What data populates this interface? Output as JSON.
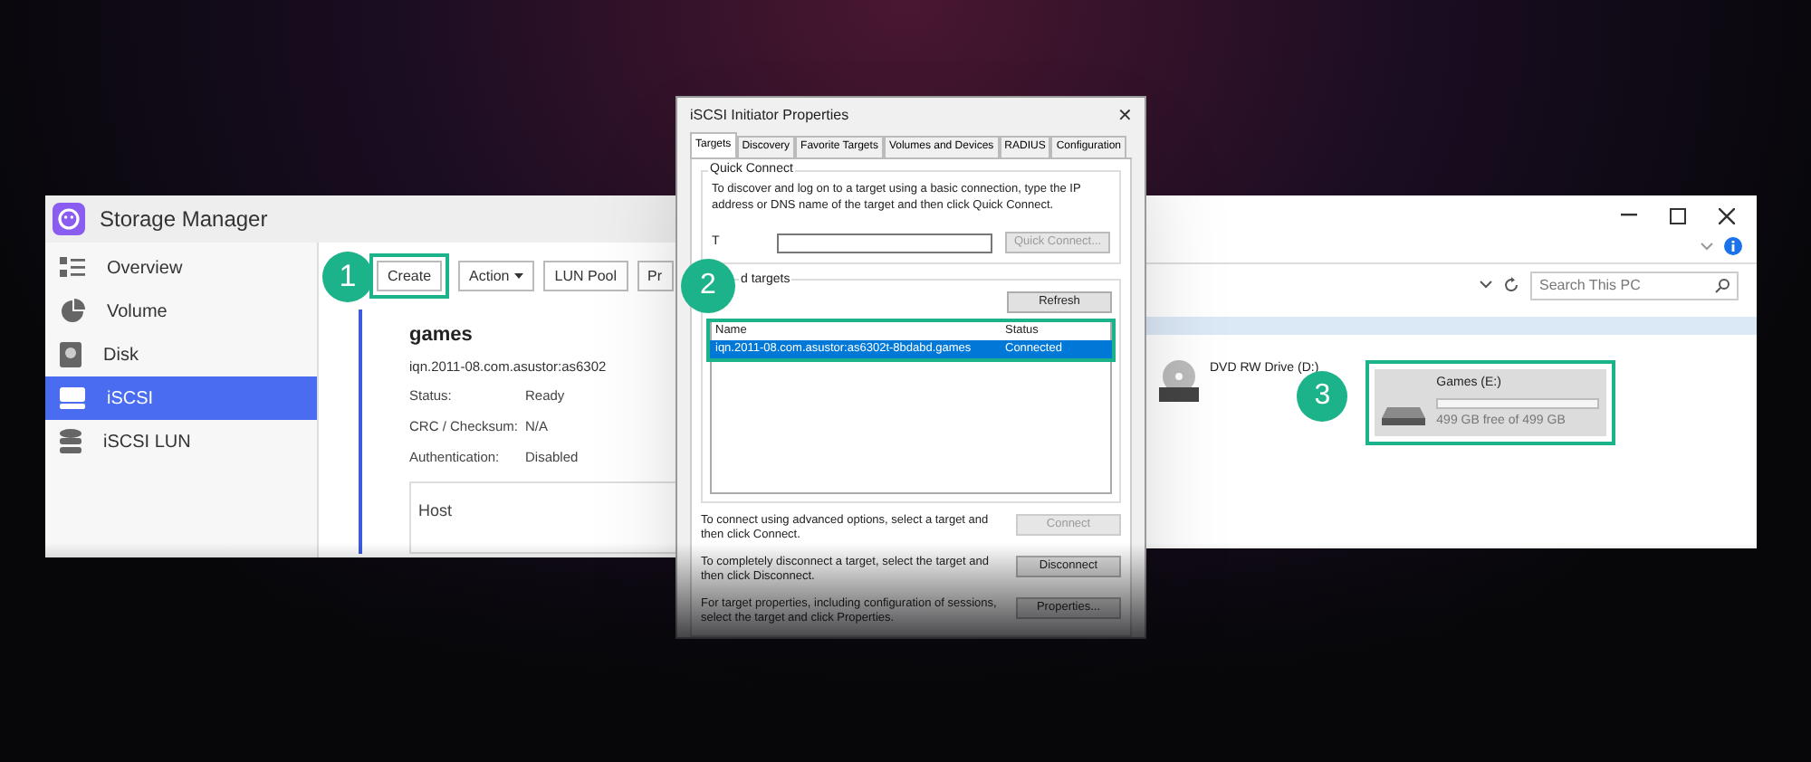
{
  "storage_manager": {
    "title": "Storage Manager",
    "sidebar": [
      {
        "kind": "overview",
        "label": "Overview",
        "selected": false
      },
      {
        "kind": "volume",
        "label": "Volume",
        "selected": false
      },
      {
        "kind": "disk",
        "label": "Disk",
        "selected": false
      },
      {
        "kind": "iscsi",
        "label": "iSCSI",
        "selected": true
      },
      {
        "kind": "lun",
        "label": "iSCSI LUN",
        "selected": false
      }
    ],
    "callout": "1",
    "toolbar": [
      {
        "label": "Create",
        "dropdown": false,
        "highlighted": true
      },
      {
        "label": "Action",
        "dropdown": true,
        "highlighted": false
      },
      {
        "label": "LUN Pool",
        "dropdown": false,
        "highlighted": false
      },
      {
        "label": "Pr",
        "dropdown": false,
        "highlighted": false
      }
    ],
    "target": {
      "name": "games",
      "iqn": "iqn.2011-08.com.asustor:as6302",
      "fields": [
        {
          "label": "Status:",
          "value": "Ready"
        },
        {
          "label": "CRC / Checksum:",
          "value": "N/A"
        },
        {
          "label": "Authentication:",
          "value": "Disabled"
        }
      ],
      "host_header": "Host"
    }
  },
  "dialog": {
    "title": "iSCSI Initiator Properties",
    "close": "✕",
    "tabs": [
      {
        "label": "Targets",
        "selected": true
      },
      {
        "label": "Discovery",
        "selected": false
      },
      {
        "label": "Favorite Targets",
        "selected": false
      },
      {
        "label": "Volumes and Devices",
        "selected": false
      },
      {
        "label": "RADIUS",
        "selected": false
      },
      {
        "label": "Configuration",
        "selected": false
      }
    ],
    "quick_connect": {
      "group_label": "Quick Connect",
      "description": "To discover and log on to a target using a basic connection, type the IP address or DNS name of the target and then click Quick Connect.",
      "target_label": "T",
      "button": "Quick Connect...",
      "button_disabled": true
    },
    "discovered": {
      "callout": "2",
      "group_label": "d targets",
      "refresh": "Refresh",
      "columns": [
        "Name",
        "Status"
      ],
      "rows": [
        {
          "name": "iqn.2011-08.com.asustor:as6302t-8bdabd.games",
          "status": "Connected",
          "selected": true
        }
      ]
    },
    "actions": [
      {
        "text": "To connect using advanced options, select a target and then click Connect.",
        "button": "Connect",
        "disabled": true
      },
      {
        "text": "To completely disconnect a target, select the target and then click Disconnect.",
        "button": "Disconnect",
        "disabled": false
      },
      {
        "text": "For target properties, including configuration of sessions, select the target and click Properties.",
        "button": "Properties...",
        "disabled": false
      }
    ]
  },
  "explorer": {
    "search_placeholder": "Search This PC",
    "drives": [
      {
        "kind": "dvd",
        "label": "DVD RW Drive (D:)",
        "highlighted": false
      },
      {
        "kind": "disk",
        "label": "Games (E:)",
        "free": "499 GB free of 499 GB",
        "level": 0,
        "highlighted": true,
        "callout": "3"
      }
    ]
  }
}
